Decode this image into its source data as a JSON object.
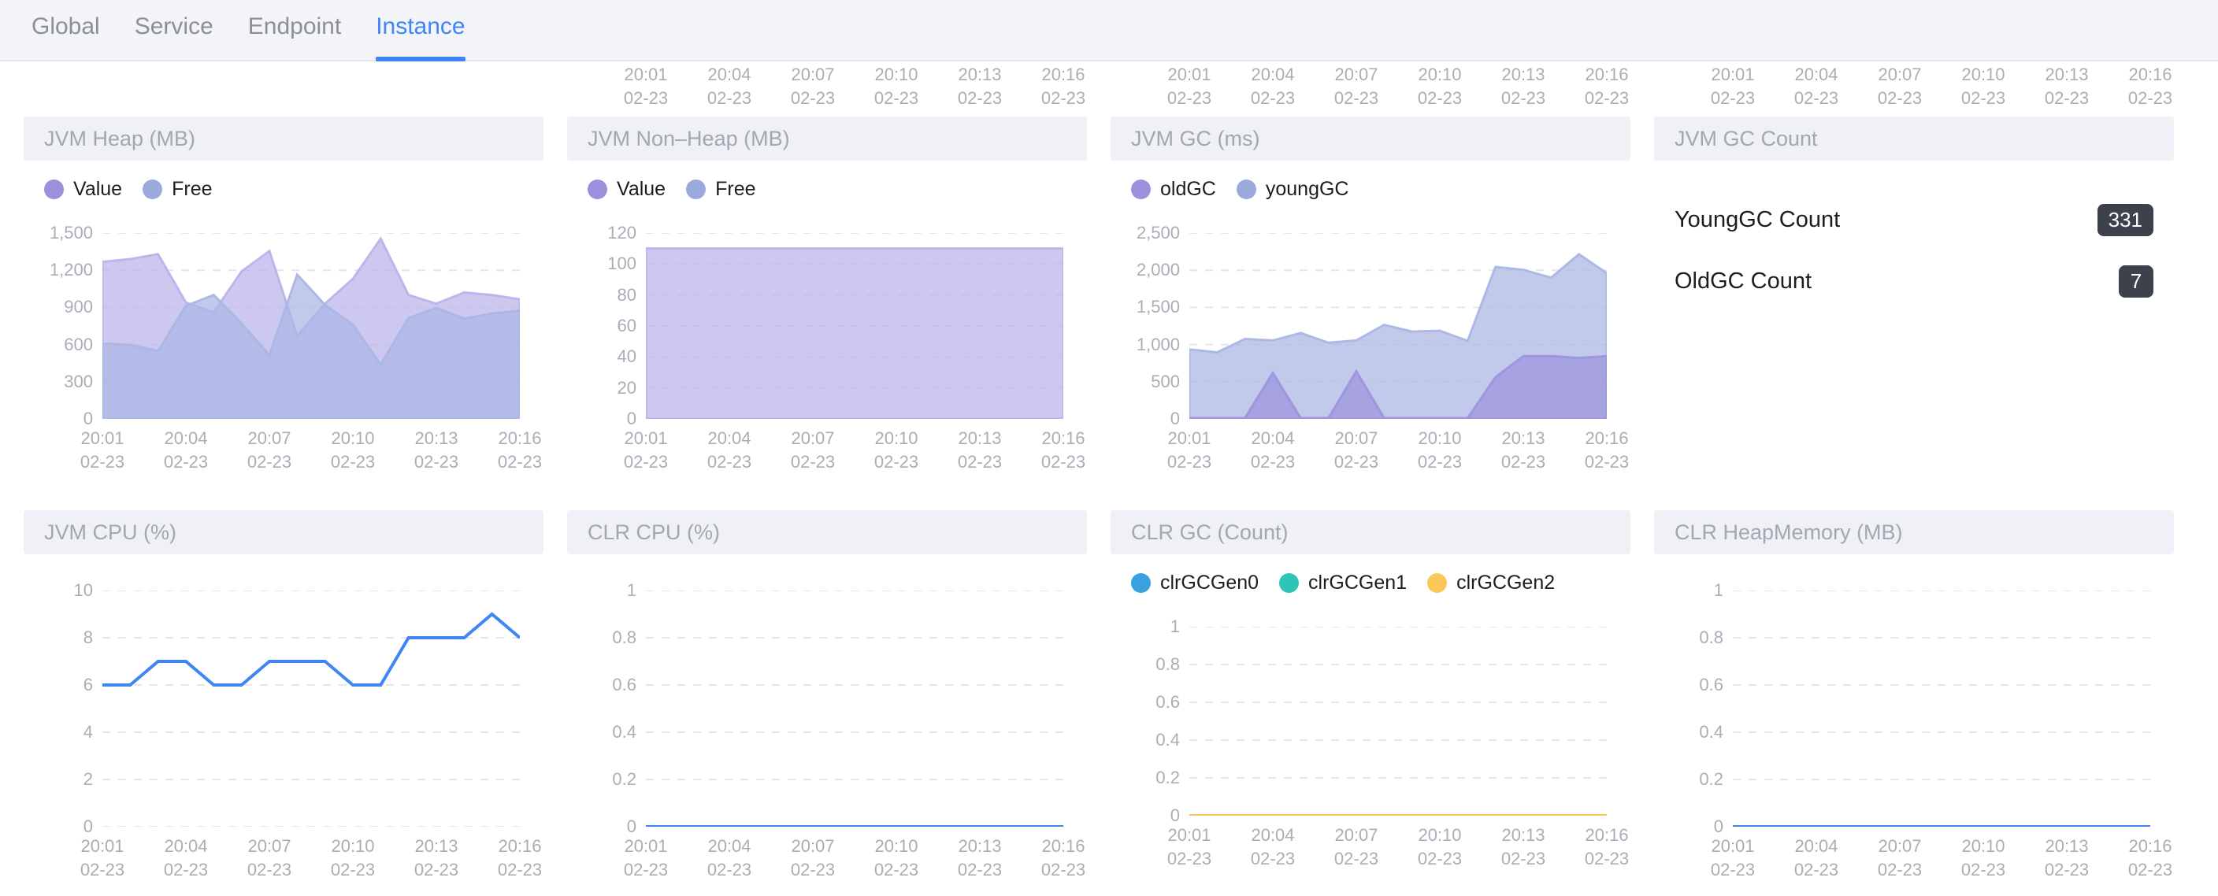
{
  "nav": {
    "tabs": [
      {
        "label": "Global",
        "active": false
      },
      {
        "label": "Service",
        "active": false
      },
      {
        "label": "Endpoint",
        "active": false
      },
      {
        "label": "Instance",
        "active": true
      }
    ]
  },
  "axis_strip": {
    "note": "clipped x-axis tick labels of the charts scrolled above",
    "ticks": [
      "20:01\n02-23",
      "20:04\n02-23",
      "20:07\n02-23",
      "20:10\n02-23",
      "20:13\n02-23",
      "20:16\n02-23"
    ],
    "columns": 3
  },
  "colors": {
    "accent": "#3f86f4",
    "value_purple": "#9d8fdb",
    "free_blue": "#9aaadd",
    "area_purple_fill": "#bab3ea",
    "area_blue_fill": "#aab6e4",
    "line_blue": "#3f86f4",
    "clr_gen0": "#3aa0e0",
    "clr_gen1": "#2ec4b6",
    "clr_gen2": "#fac858",
    "badge_bg": "#3d414b",
    "panel_head_bg": "#eff1f6",
    "nav_bg": "#f3f4f8",
    "axis_text": "#a9aeb6"
  },
  "panels": [
    {
      "id": "jvm-heap",
      "title": "JVM Heap (MB)"
    },
    {
      "id": "jvm-nonheap",
      "title": "JVM Non–Heap (MB)"
    },
    {
      "id": "jvm-gc",
      "title": "JVM GC (ms)"
    },
    {
      "id": "jvm-gc-count",
      "title": "JVM GC Count"
    },
    {
      "id": "jvm-cpu",
      "title": "JVM CPU (%)"
    },
    {
      "id": "clr-cpu",
      "title": "CLR CPU (%)"
    },
    {
      "id": "clr-gc",
      "title": "CLR GC (Count)"
    },
    {
      "id": "clr-heap",
      "title": "CLR HeapMemory (MB)"
    }
  ],
  "gc_count": {
    "rows": [
      {
        "label": "YoungGC Count",
        "value": "331"
      },
      {
        "label": "OldGC Count",
        "value": "7"
      }
    ]
  },
  "chart_data": [
    {
      "id": "jvm-heap",
      "type": "area",
      "title": "JVM Heap (MB)",
      "xlabel": "",
      "ylabel": "MB",
      "ylim": [
        0,
        1500
      ],
      "yticks": [
        0,
        300,
        600,
        900,
        1200,
        1500
      ],
      "ytick_labels": [
        "0",
        "300",
        "600",
        "900",
        "1,200",
        "1,500"
      ],
      "grid": true,
      "legend": [
        "Value",
        "Free"
      ],
      "legend_position": "top-left",
      "x": [
        "20:01",
        "20:02",
        "20:03",
        "20:04",
        "20:05",
        "20:06",
        "20:07",
        "20:08",
        "20:09",
        "20:10",
        "20:11",
        "20:12",
        "20:13",
        "20:14",
        "20:15",
        "20:16"
      ],
      "xtick_labels": [
        "20:01\n02-23",
        "20:04\n02-23",
        "20:07\n02-23",
        "20:10\n02-23",
        "20:13\n02-23",
        "20:16\n02-23"
      ],
      "series": [
        {
          "name": "Value",
          "color": "#bab3ea",
          "values": [
            1268,
            1290,
            1330,
            940,
            860,
            1190,
            1355,
            670,
            930,
            1130,
            1455,
            1000,
            930,
            1020,
            1000,
            965
          ]
        },
        {
          "name": "Free",
          "color": "#aab6e4",
          "values": [
            608,
            598,
            548,
            912,
            1000,
            770,
            515,
            1165,
            920,
            760,
            440,
            815,
            895,
            810,
            850,
            875
          ]
        }
      ]
    },
    {
      "id": "jvm-nonheap",
      "type": "area",
      "title": "JVM Non–Heap (MB)",
      "xlabel": "",
      "ylabel": "MB",
      "ylim": [
        0,
        120
      ],
      "yticks": [
        0,
        20,
        40,
        60,
        80,
        100,
        120
      ],
      "ytick_labels": [
        "0",
        "20",
        "40",
        "60",
        "80",
        "100",
        "120"
      ],
      "grid": true,
      "legend": [
        "Value",
        "Free"
      ],
      "legend_position": "top-left",
      "x": [
        "20:01",
        "20:02",
        "20:03",
        "20:04",
        "20:05",
        "20:06",
        "20:07",
        "20:08",
        "20:09",
        "20:10",
        "20:11",
        "20:12",
        "20:13",
        "20:14",
        "20:15",
        "20:16"
      ],
      "xtick_labels": [
        "20:01\n02-23",
        "20:04\n02-23",
        "20:07\n02-23",
        "20:10\n02-23",
        "20:13\n02-23",
        "20:16\n02-23"
      ],
      "series": [
        {
          "name": "Value",
          "color": "#bab3ea",
          "values": [
            110,
            110,
            110,
            110,
            110,
            110,
            110,
            110,
            110,
            110,
            110,
            110,
            110,
            110,
            110,
            110
          ]
        },
        {
          "name": "Free",
          "color": "#aab6e4",
          "values": [
            0,
            0,
            0,
            0,
            0,
            0,
            0,
            0,
            0,
            0,
            0,
            0,
            0,
            0,
            0,
            0
          ]
        }
      ]
    },
    {
      "id": "jvm-gc",
      "type": "area",
      "title": "JVM GC (ms)",
      "xlabel": "",
      "ylabel": "ms",
      "ylim": [
        0,
        2500
      ],
      "yticks": [
        0,
        500,
        1000,
        1500,
        2000,
        2500
      ],
      "ytick_labels": [
        "0",
        "500",
        "1,000",
        "1,500",
        "2,000",
        "2,500"
      ],
      "grid": true,
      "legend": [
        "oldGC",
        "youngGC"
      ],
      "legend_position": "top-left",
      "x": [
        "20:01",
        "20:02",
        "20:03",
        "20:04",
        "20:05",
        "20:06",
        "20:07",
        "20:08",
        "20:09",
        "20:10",
        "20:11",
        "20:12",
        "20:13",
        "20:14",
        "20:15",
        "20:16"
      ],
      "xtick_labels": [
        "20:01\n02-23",
        "20:04\n02-23",
        "20:07\n02-23",
        "20:10\n02-23",
        "20:13\n02-23",
        "20:16\n02-23"
      ],
      "series": [
        {
          "name": "youngGC",
          "color": "#aab6e4",
          "values": [
            935,
            895,
            1075,
            1055,
            1155,
            1025,
            1055,
            1265,
            1175,
            1185,
            1050,
            2045,
            2005,
            1900,
            2215,
            1960
          ]
        },
        {
          "name": "oldGC",
          "color": "#9d93de",
          "values": [
            10,
            10,
            10,
            620,
            10,
            10,
            640,
            10,
            10,
            10,
            10,
            560,
            845,
            845,
            820,
            845
          ]
        }
      ]
    },
    {
      "id": "jvm-cpu",
      "type": "line",
      "title": "JVM CPU (%)",
      "xlabel": "",
      "ylabel": "%",
      "ylim": [
        0,
        10
      ],
      "yticks": [
        0,
        2,
        4,
        6,
        8,
        10
      ],
      "ytick_labels": [
        "0",
        "2",
        "4",
        "6",
        "8",
        "10"
      ],
      "grid": true,
      "legend": [],
      "x": [
        "20:01",
        "20:02",
        "20:03",
        "20:04",
        "20:05",
        "20:06",
        "20:07",
        "20:08",
        "20:09",
        "20:10",
        "20:11",
        "20:12",
        "20:13",
        "20:14",
        "20:15",
        "20:16"
      ],
      "xtick_labels": [
        "20:01\n02-23",
        "20:04\n02-23",
        "20:07\n02-23",
        "20:10\n02-23",
        "20:13\n02-23",
        "20:16\n02-23"
      ],
      "series": [
        {
          "name": "JVM CPU",
          "color": "#3f86f4",
          "values": [
            6,
            6,
            7,
            7,
            6,
            6,
            7,
            7,
            7,
            6,
            6,
            8,
            8,
            8,
            9,
            8
          ]
        }
      ]
    },
    {
      "id": "clr-cpu",
      "type": "line",
      "title": "CLR CPU (%)",
      "xlabel": "",
      "ylabel": "%",
      "ylim": [
        0,
        1
      ],
      "yticks": [
        0,
        0.2,
        0.4,
        0.6,
        0.8,
        1
      ],
      "ytick_labels": [
        "0",
        "0.2",
        "0.4",
        "0.6",
        "0.8",
        "1"
      ],
      "grid": true,
      "legend": [],
      "x": [
        "20:01",
        "20:02",
        "20:03",
        "20:04",
        "20:05",
        "20:06",
        "20:07",
        "20:08",
        "20:09",
        "20:10",
        "20:11",
        "20:12",
        "20:13",
        "20:14",
        "20:15",
        "20:16"
      ],
      "xtick_labels": [
        "20:01\n02-23",
        "20:04\n02-23",
        "20:07\n02-23",
        "20:10\n02-23",
        "20:13\n02-23",
        "20:16\n02-23"
      ],
      "series": [
        {
          "name": "CLR CPU",
          "color": "#3f86f4",
          "values": [
            0,
            0,
            0,
            0,
            0,
            0,
            0,
            0,
            0,
            0,
            0,
            0,
            0,
            0,
            0,
            0
          ]
        }
      ]
    },
    {
      "id": "clr-gc",
      "type": "line",
      "title": "CLR GC (Count)",
      "xlabel": "",
      "ylabel": "Count",
      "ylim": [
        0,
        1
      ],
      "yticks": [
        0,
        0.2,
        0.4,
        0.6,
        0.8,
        1
      ],
      "ytick_labels": [
        "0",
        "0.2",
        "0.4",
        "0.6",
        "0.8",
        "1"
      ],
      "grid": true,
      "legend": [
        "clrGCGen0",
        "clrGCGen1",
        "clrGCGen2"
      ],
      "legend_position": "top-left",
      "x": [
        "20:01",
        "20:02",
        "20:03",
        "20:04",
        "20:05",
        "20:06",
        "20:07",
        "20:08",
        "20:09",
        "20:10",
        "20:11",
        "20:12",
        "20:13",
        "20:14",
        "20:15",
        "20:16"
      ],
      "xtick_labels": [
        "20:01\n02-23",
        "20:04\n02-23",
        "20:07\n02-23",
        "20:10\n02-23",
        "20:13\n02-23",
        "20:16\n02-23"
      ],
      "series": [
        {
          "name": "clrGCGen0",
          "color": "#3aa0e0",
          "values": [
            0,
            0,
            0,
            0,
            0,
            0,
            0,
            0,
            0,
            0,
            0,
            0,
            0,
            0,
            0,
            0
          ]
        },
        {
          "name": "clrGCGen1",
          "color": "#2ec4b6",
          "values": [
            0,
            0,
            0,
            0,
            0,
            0,
            0,
            0,
            0,
            0,
            0,
            0,
            0,
            0,
            0,
            0
          ]
        },
        {
          "name": "clrGCGen2",
          "color": "#fac858",
          "values": [
            0,
            0,
            0,
            0,
            0,
            0,
            0,
            0,
            0,
            0,
            0,
            0,
            0,
            0,
            0,
            0
          ]
        }
      ]
    },
    {
      "id": "clr-heap",
      "type": "line",
      "title": "CLR HeapMemory (MB)",
      "xlabel": "",
      "ylabel": "MB",
      "ylim": [
        0,
        1
      ],
      "yticks": [
        0,
        0.2,
        0.4,
        0.6,
        0.8,
        1
      ],
      "ytick_labels": [
        "0",
        "0.2",
        "0.4",
        "0.6",
        "0.8",
        "1"
      ],
      "grid": true,
      "legend": [],
      "x": [
        "20:01",
        "20:02",
        "20:03",
        "20:04",
        "20:05",
        "20:06",
        "20:07",
        "20:08",
        "20:09",
        "20:10",
        "20:11",
        "20:12",
        "20:13",
        "20:14",
        "20:15",
        "20:16"
      ],
      "xtick_labels": [
        "20:01\n02-23",
        "20:04\n02-23",
        "20:07\n02-23",
        "20:10\n02-23",
        "20:13\n02-23",
        "20:16\n02-23"
      ],
      "series": [
        {
          "name": "CLR HeapMemory",
          "color": "#3f86f4",
          "values": [
            0,
            0,
            0,
            0,
            0,
            0,
            0,
            0,
            0,
            0,
            0,
            0,
            0,
            0,
            0,
            0
          ]
        }
      ]
    }
  ]
}
